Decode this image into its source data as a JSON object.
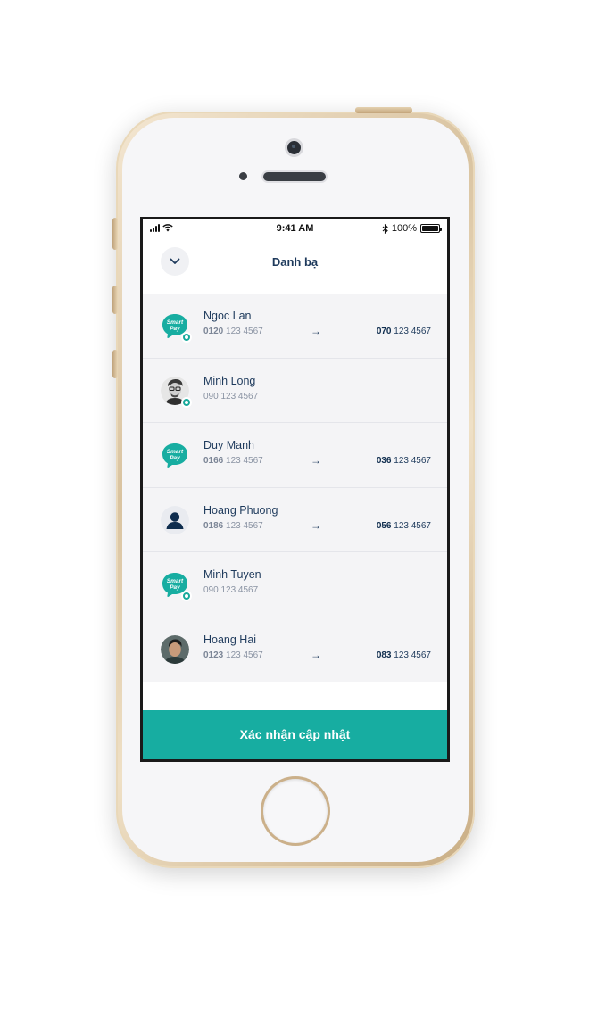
{
  "colors": {
    "accent": "#17ada1",
    "text_primary": "#1e3a5c",
    "text_secondary": "#8a93a3",
    "list_bg": "#f4f4f6"
  },
  "status_bar": {
    "time": "9:41 AM",
    "battery": "100%",
    "battery_level": 1.0,
    "icons": [
      "signal-icon",
      "wifi-icon",
      "bluetooth-icon",
      "battery-icon"
    ]
  },
  "header": {
    "title": "Danh bạ",
    "back_icon": "chevron-down-icon"
  },
  "contacts": [
    {
      "name": "Ngoc Lan",
      "avatar": "smartpay-logo",
      "badge": true,
      "old_prefix": "0120",
      "old_rest": "123 4567",
      "arrow": "→",
      "new_prefix": "070",
      "new_rest": "123 4567"
    },
    {
      "name": "Minh Long",
      "avatar": "photo-man-glasses",
      "badge": true,
      "old_prefix": "",
      "old_rest": "090 123 4567",
      "arrow": "",
      "new_prefix": "",
      "new_rest": ""
    },
    {
      "name": "Duy Manh",
      "avatar": "smartpay-logo",
      "badge": false,
      "old_prefix": "0166",
      "old_rest": "123 4567",
      "arrow": "→",
      "new_prefix": "036",
      "new_rest": "123 4567"
    },
    {
      "name": "Hoang Phuong",
      "avatar": "person-silhouette",
      "badge": false,
      "old_prefix": "0186",
      "old_rest": "123 4567",
      "arrow": "→",
      "new_prefix": "056",
      "new_rest": "123 4567"
    },
    {
      "name": "Minh Tuyen",
      "avatar": "smartpay-logo",
      "badge": true,
      "old_prefix": "",
      "old_rest": "090 123 4567",
      "arrow": "",
      "new_prefix": "",
      "new_rest": ""
    },
    {
      "name": "Hoang Hai",
      "avatar": "photo-man",
      "badge": false,
      "old_prefix": "0123",
      "old_rest": "123 4567",
      "arrow": "→",
      "new_prefix": "083",
      "new_rest": "123 4567"
    }
  ],
  "logo_text": "Smart Pay",
  "confirm_button": {
    "label": "Xác nhận cập nhật"
  }
}
